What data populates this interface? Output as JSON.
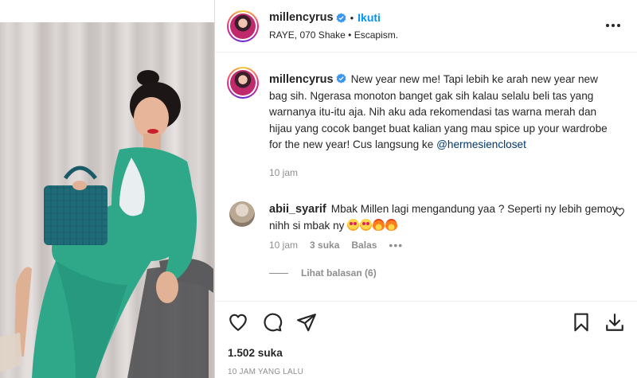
{
  "post": {
    "username": "millencyrus",
    "follow_label": "Ikuti",
    "separator": "•",
    "music": "RAYE, 070 Shake • Escapism.",
    "caption": {
      "text": "New year new me! Tapi lebih ke arah new year new bag sih. Ngerasa monoton banget gak sih kalau selalu beli tas yang warnanya itu-itu aja. Nih aku ada rekomendasi tas warna merah dan hijau yang cocok banget buat kalian yang mau spice up your wardrobe for the new year! Cus langsung ke ",
      "mention": "@hermesiencloset",
      "time": "10 jam"
    },
    "comment": {
      "username": "abii_syarif",
      "text": "Mbak Millen lagi mengandung yaa ? Seperti ny lebih gemoy nihh si mbak ny ",
      "emojis": [
        "heart-eyes-emoji",
        "heart-eyes-emoji",
        "fire-emoji",
        "fire-emoji"
      ],
      "time": "10 jam",
      "likes": "3 suka",
      "reply_label": "Balas",
      "more": "•••",
      "view_replies": "Lihat balasan (6)"
    },
    "likes_count": "1.502 suka",
    "posted_ago": "10 JAM YANG LALU"
  },
  "icons": {
    "verified": "verified-badge-icon",
    "more": "more-options-icon",
    "like": "heart-icon",
    "comment": "comment-icon",
    "share": "share-icon",
    "save": "bookmark-icon",
    "download": "download-icon"
  },
  "colors": {
    "link_blue": "#0095f6",
    "verified_blue": "#3897f0",
    "mention": "#00376b",
    "text": "#262626",
    "muted": "#8e8e8e",
    "dress_green": "#2fa88a",
    "bag_teal": "#1f6b78"
  }
}
